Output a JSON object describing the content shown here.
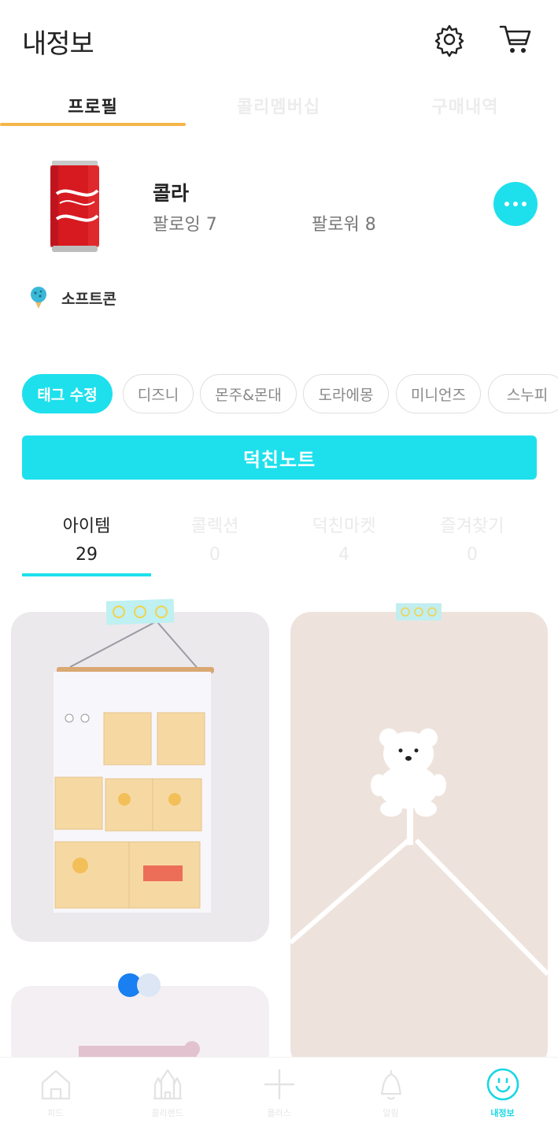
{
  "header": {
    "title": "내정보",
    "icons": [
      "gear-icon",
      "cart-icon"
    ]
  },
  "top_tabs": [
    {
      "label": "프로필",
      "active": true
    },
    {
      "label": "콜리멤버십",
      "active": false
    },
    {
      "label": "구매내역",
      "active": false
    }
  ],
  "profile": {
    "name": "콜라",
    "following": "팔로잉 7",
    "followers": "팔로워 8",
    "badge_label": "소프트콘"
  },
  "tags": [
    "태그 수정",
    "디즈니",
    "몬주&몬대",
    "도라에몽",
    "미니언즈",
    "스누피"
  ],
  "note_button": "덕친노트",
  "sub_tabs": [
    {
      "label": "아이템",
      "count": "29",
      "active": true
    },
    {
      "label": "콜렉션",
      "count": "0",
      "active": false
    },
    {
      "label": "덕친마켓",
      "count": "4",
      "active": false
    },
    {
      "label": "즐겨찾기",
      "count": "0",
      "active": false
    }
  ],
  "items": [
    {
      "image": "pooh-wall-organizer"
    },
    {
      "image": "bear-hook"
    },
    {
      "image": "pink-card"
    }
  ],
  "bottom_nav": [
    {
      "label": "피드",
      "icon": "home-icon",
      "active": false
    },
    {
      "label": "콜리랜드",
      "icon": "castle-icon",
      "active": false
    },
    {
      "label": "플러스",
      "icon": "plus-icon",
      "active": false
    },
    {
      "label": "알림",
      "icon": "bell-icon",
      "active": false
    },
    {
      "label": "내정보",
      "icon": "smile-icon",
      "active": true
    }
  ],
  "colors": {
    "accent": "#1ee0ec",
    "tab_underline": "#f5b64a"
  }
}
